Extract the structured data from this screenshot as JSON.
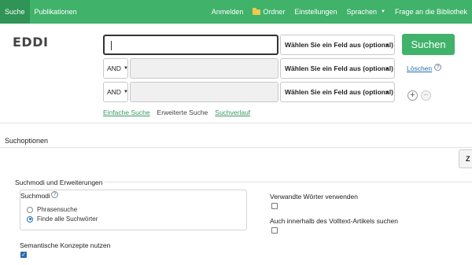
{
  "nav": {
    "left": [
      {
        "label": "Suche",
        "active": true
      },
      {
        "label": "Publikationen",
        "active": false
      }
    ],
    "anmelden": "Anmelden",
    "ordner": "Ordner",
    "einstellungen": "Einstellungen",
    "sprachen": "Sprachen",
    "frage": "Frage an die Bibliothek"
  },
  "logo": "EDDI",
  "search": {
    "field_placeholder": "Wählen Sie ein Feld aus (optional)",
    "bool_value": "AND",
    "search_button": "Suchen",
    "clear_link": "Löschen",
    "help_glyph": "?",
    "links": {
      "simple": "Einfache Suche",
      "advanced": "Erweiterte Suche",
      "history": "Suchverlauf"
    }
  },
  "options": {
    "title": "Suchoptionen",
    "z_button": "Z",
    "subsection": "Suchmodi und Erweiterungen",
    "modi_title": "Suchmodi",
    "modi": [
      {
        "label": "Phrasensuche",
        "selected": false
      },
      {
        "label": "Finde alle Suchwörter",
        "selected": true
      }
    ],
    "semantic": {
      "label": "Semantische Konzepte nutzen",
      "checked": true
    },
    "related": {
      "label": "Verwandte Wörter verwenden",
      "checked": false
    },
    "fulltext": {
      "label": "Auch innerhalb des Volltext-Artikels suchen",
      "checked": false
    }
  },
  "colors": {
    "brand_green": "#40b26a",
    "link_blue": "#2a6db0"
  }
}
